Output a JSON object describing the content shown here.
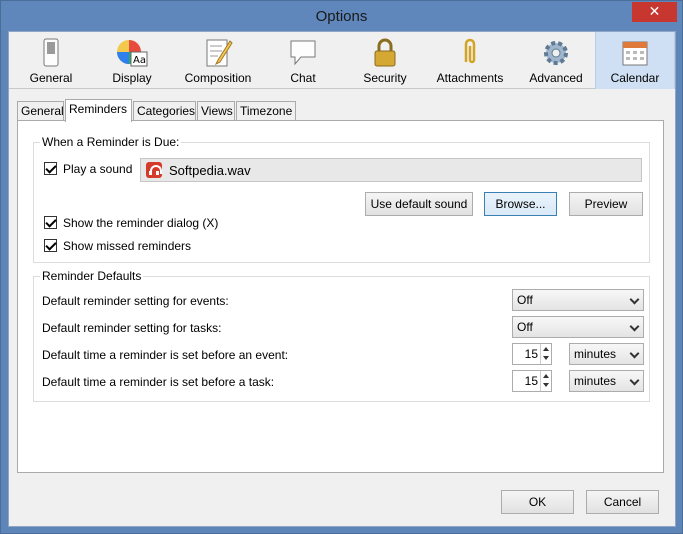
{
  "window": {
    "title": "Options",
    "close_glyph": "✕"
  },
  "toolbar": {
    "items": [
      {
        "label": "General",
        "icon": "switch-icon"
      },
      {
        "label": "Display",
        "icon": "color-palette-icon"
      },
      {
        "label": "Composition",
        "icon": "document-pencil-icon"
      },
      {
        "label": "Chat",
        "icon": "chat-bubble-icon"
      },
      {
        "label": "Security",
        "icon": "padlock-icon"
      },
      {
        "label": "Attachments",
        "icon": "paperclip-icon"
      },
      {
        "label": "Advanced",
        "icon": "gear-icon"
      },
      {
        "label": "Calendar",
        "icon": "calendar-icon",
        "selected": true
      }
    ]
  },
  "tabs": [
    {
      "label": "General"
    },
    {
      "label": "Reminders",
      "active": true
    },
    {
      "label": "Categories"
    },
    {
      "label": "Views"
    },
    {
      "label": "Timezone"
    }
  ],
  "reminder_due": {
    "legend": "When a Reminder is Due:",
    "play_sound": {
      "label": "Play a sound",
      "checked": true
    },
    "sound_file": "Softpedia.wav",
    "use_default_label": "Use default sound",
    "browse_label": "Browse...",
    "preview_label": "Preview",
    "show_dialog": {
      "label": "Show the reminder dialog (X)",
      "checked": true
    },
    "show_missed": {
      "label": "Show missed reminders",
      "checked": true
    }
  },
  "defaults": {
    "legend": "Reminder Defaults",
    "rows": [
      {
        "label": "Default reminder setting for events:",
        "value": "Off"
      },
      {
        "label": "Default reminder setting for tasks:",
        "value": "Off"
      },
      {
        "label": "Default time a reminder is set before an event:",
        "number": "15",
        "unit": "minutes"
      },
      {
        "label": "Default time a reminder is set before a task:",
        "number": "15",
        "unit": "minutes"
      }
    ]
  },
  "footer": {
    "ok_label": "OK",
    "cancel_label": "Cancel"
  },
  "colors": {
    "titlebar": "#5f87bb",
    "selected_toolbar": "#cfe0f4",
    "close_button": "#c7372f"
  }
}
